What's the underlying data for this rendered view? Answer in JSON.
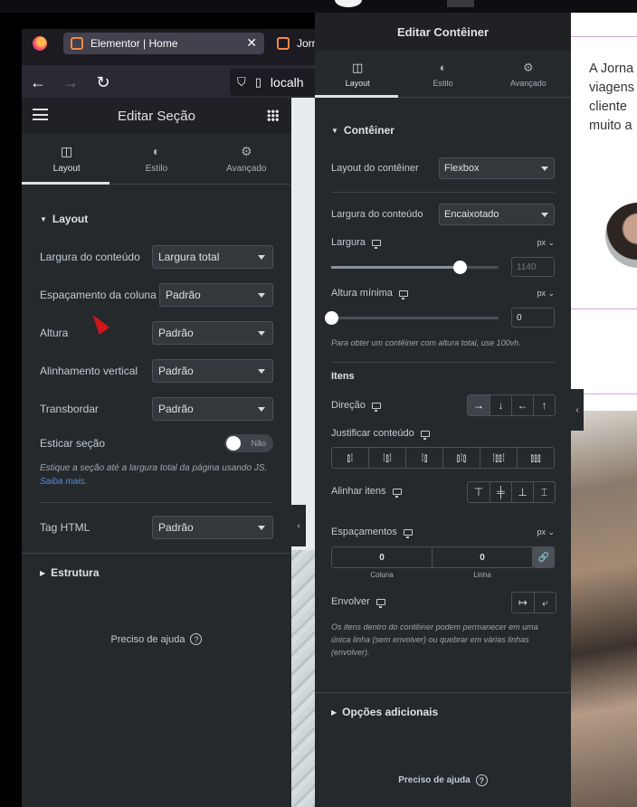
{
  "browser": {
    "tab_active": "Elementor | Home",
    "tab_other": "Jorna",
    "url": "localh"
  },
  "left_panel": {
    "header_title": "Editar Seção",
    "tabs": [
      {
        "label": "Layout",
        "icon": "layout-icon"
      },
      {
        "label": "Estilo",
        "icon": "contrast-icon"
      },
      {
        "label": "Avançado",
        "icon": "gear-icon"
      }
    ],
    "section_title": "Layout",
    "fields": {
      "content_width": {
        "label": "Largura do conteúdo",
        "value": "Largura total"
      },
      "column_gap": {
        "label": "Espaçamento da coluna",
        "value": "Padrão"
      },
      "height": {
        "label": "Altura",
        "value": "Padrão"
      },
      "vertical_align": {
        "label": "Alinhamento vertical",
        "value": "Padrão"
      },
      "overflow": {
        "label": "Transbordar",
        "value": "Padrão"
      },
      "stretch": {
        "label": "Esticar seção",
        "toggle_label": "Não"
      },
      "html_tag": {
        "label": "Tag HTML",
        "value": "Padrão"
      }
    },
    "stretch_note": "Estique a seção até a largura total da página usando JS.",
    "stretch_link": "Saiba mais.",
    "structure_title": "Estrutura",
    "help": "Preciso de ajuda"
  },
  "right_panel": {
    "header_title": "Editar Contêiner",
    "tabs": [
      {
        "label": "Layout",
        "icon": "layout-icon"
      },
      {
        "label": "Estilo",
        "icon": "contrast-icon"
      },
      {
        "label": "Avançado",
        "icon": "gear-icon"
      }
    ],
    "section_title": "Contêiner",
    "container_layout": {
      "label": "Layout do contêiner",
      "value": "Flexbox"
    },
    "content_width": {
      "label": "Largura do conteúdo",
      "value": "Encaixotado"
    },
    "width": {
      "label": "Largura",
      "unit": "px",
      "placeholder": "1140",
      "slider_fraction": 0.77
    },
    "min_height": {
      "label": "Altura mínima",
      "unit": "px",
      "value": "0",
      "slider_fraction": 0.0
    },
    "min_height_note": "Para obter um contêiner com altura total, use 100vh.",
    "items_title": "Itens",
    "direction": {
      "label": "Direção",
      "options": [
        "→",
        "↓",
        "←",
        "↑"
      ],
      "selected": 0
    },
    "justify": {
      "label": "Justificar conteúdo",
      "options": [
        "justify-start-icon",
        "justify-center-icon",
        "justify-end-icon",
        "justify-between-icon",
        "justify-around-icon",
        "justify-evenly-icon"
      ]
    },
    "align": {
      "label": "Alinhar itens",
      "options": [
        "align-start-icon",
        "align-center-icon",
        "align-end-icon",
        "align-stretch-icon"
      ]
    },
    "gaps": {
      "label": "Espaçamentos",
      "unit": "px",
      "column_value": "0",
      "column_label": "Coluna",
      "row_value": "0",
      "row_label": "Linha"
    },
    "wrap": {
      "label": "Envolver",
      "options": [
        "nowrap-icon",
        "wrap-icon"
      ]
    },
    "wrap_note": "Os itens dentro do contêiner podem permanecer em uma única linha (sem envolver) ou quebrar em várias linhas (envolver).",
    "extra_title": "Opções adicionais",
    "help": "Preciso de ajuda"
  },
  "site": {
    "text_lines": [
      "A Jorna",
      "viagens",
      "cliente",
      "muito a"
    ]
  }
}
